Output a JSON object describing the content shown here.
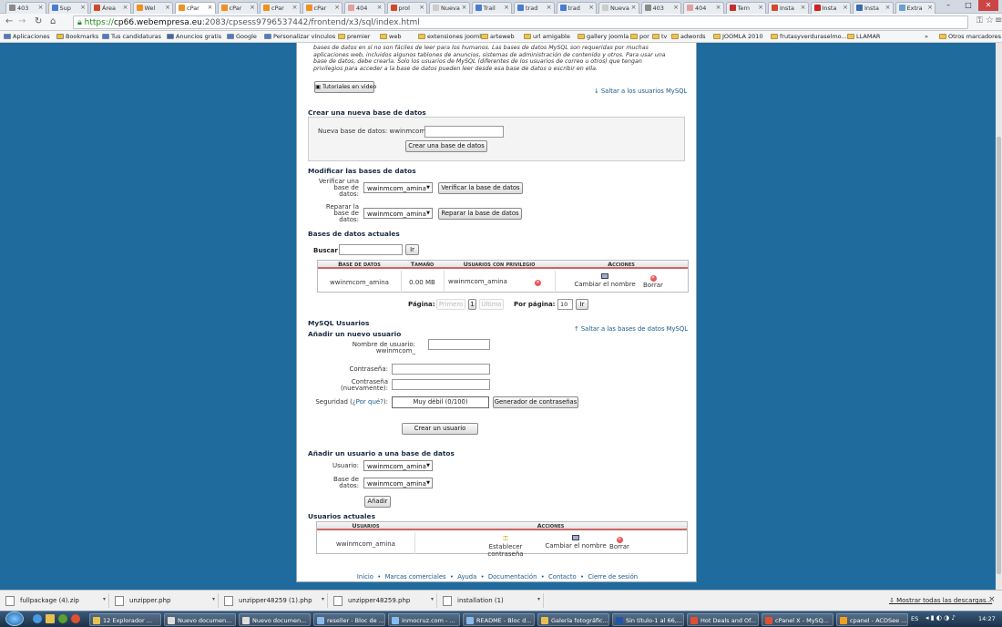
{
  "browser": {
    "tabs": [
      {
        "label": "403",
        "color": "#8a8a8a"
      },
      {
        "label": "Sup",
        "color": "#4a7bd0"
      },
      {
        "label": "Área",
        "color": "#d04a2a"
      },
      {
        "label": "Wel",
        "color": "#f09020"
      },
      {
        "label": "cPar",
        "color": "#f09020",
        "active": true
      },
      {
        "label": "cPar",
        "color": "#f09020"
      },
      {
        "label": "cPar",
        "color": "#f09020"
      },
      {
        "label": "cPar",
        "color": "#f09020"
      },
      {
        "label": "404",
        "color": "#e0a0a0"
      },
      {
        "label": "prol",
        "color": "#d04a2a"
      },
      {
        "label": "Nueva",
        "color": "#cccccc"
      },
      {
        "label": "Trail",
        "color": "#4a7bd0"
      },
      {
        "label": "trad",
        "color": "#4a7bd0"
      },
      {
        "label": "trad",
        "color": "#4a7bd0"
      },
      {
        "label": "Nueva",
        "color": "#cccccc"
      },
      {
        "label": "403",
        "color": "#8a8a8a"
      },
      {
        "label": "404",
        "color": "#e0a0a0"
      },
      {
        "label": "Tern",
        "color": "#c03030"
      },
      {
        "label": "Insta",
        "color": "#d04a2a"
      },
      {
        "label": "Insta",
        "color": "#d02020"
      },
      {
        "label": "Insta",
        "color": "#3a6ab0"
      },
      {
        "label": "Extra",
        "color": "#6aa0d0"
      }
    ],
    "url_scheme": "https://",
    "url_host": "cp66.webempresa.eu",
    "url_path": ":2083/cpsess9796537442/frontend/x3/sql/index.html",
    "bookmarks": [
      {
        "label": "Aplicaciones"
      },
      {
        "label": "Bookmarks"
      },
      {
        "label": "Tus candidaturas"
      },
      {
        "label": "Anuncios gratis"
      },
      {
        "label": "Google"
      },
      {
        "label": "Personalizar vínculos"
      },
      {
        "label": "premier"
      },
      {
        "label": "web"
      },
      {
        "label": "extensiones joomla"
      },
      {
        "label": "arteweb"
      },
      {
        "label": "url amigable"
      },
      {
        "label": "gallery joomla"
      },
      {
        "label": "por"
      },
      {
        "label": "tv"
      },
      {
        "label": "adwords"
      },
      {
        "label": "JOOMLA 2010"
      },
      {
        "label": "frutasyverduraselmo..."
      },
      {
        "label": "LLAMAR"
      }
    ],
    "other_bookmarks": "Otros marcadores",
    "more": "»"
  },
  "page": {
    "intro_lines": [
      "bases de datos en sí no son fáciles de leer para los humanos. Las bases de datos MySQL son requeridas por muchas",
      "aplicaciones web, incluidos algunos tablones de anuncios, sistemas de administración de contenido y otros. Para usar una",
      "base de datos, debe crearla. Solo los usuarios de MySQL (diferentes de los usuarios de correo u otros) que tengan",
      "privilegios para acceder a la base de datos pueden leer desde esa base de datos o escribir en ella."
    ],
    "video_button": "Tutoriales en video",
    "jump_users_link": "↓ Saltar a los usuarios MySQL",
    "create_db": {
      "heading": "Crear una nueva base de datos",
      "label": "Nueva base de datos:",
      "prefix": "wwinmcom_",
      "value": "",
      "button": "Crear una base de datos"
    },
    "modify_db": {
      "heading": "Modificar las bases de datos",
      "check_label": "Verificar una base de datos:",
      "check_select": "wwinmcom_amina",
      "check_button": "Verificar la base de datos",
      "repair_label": "Reparar la base de datos:",
      "repair_select": "wwinmcom_amina",
      "repair_button": "Reparar la base de datos"
    },
    "current_dbs": {
      "heading": "Bases de datos actuales",
      "search_label": "Buscar",
      "search_value": "",
      "go_button": "Ir",
      "columns": [
        "Base de datos",
        "Tamaño",
        "Usuarios con privilegio",
        "Acciones"
      ],
      "rows": [
        {
          "name": "wwinmcom_amina",
          "size": "0.00 MB",
          "user": "wwinmcom_amina",
          "action_rename": "Cambiar el nombre",
          "action_delete": "Borrar"
        }
      ],
      "pagination": {
        "label": "Página:",
        "first": "Primero",
        "current": "1",
        "last": "Último",
        "per_page_label": "Por página:",
        "per_page_value": "10",
        "go": "Ir"
      }
    },
    "mysql_users": {
      "heading": "MySQL Usuarios",
      "subheading": "Añadir un nuevo usuario",
      "jump_db_link": "↑ Saltar a las bases de datos MySQL",
      "username_label": "Nombre de usuario:",
      "username_prefix": "wwinmcom_",
      "password_label": "Contraseña:",
      "password2_label": "Contraseña (nuevamente):",
      "security_label": "Seguridad (",
      "security_why": "¿Por qué?",
      "security_suffix": "):",
      "strength": "Muy débil (0/100)",
      "generator_button": "Generador de contraseñas",
      "create_button": "Crear un usuario"
    },
    "add_user_db": {
      "heading": "Añadir un usuario a una base de datos",
      "user_label": "Usuario:",
      "user_select": "wwinmcom_amina",
      "db_label": "Base de datos:",
      "db_select": "wwinmcom_amina",
      "add_button": "Añadir"
    },
    "current_users": {
      "heading": "Usuarios actuales",
      "columns": [
        "Usuarios",
        "Acciones"
      ],
      "rows": [
        {
          "name": "wwinmcom_amina",
          "set_password": "Establecer contraseña",
          "rename": "Cambiar el nombre",
          "delete": "Borrar"
        }
      ]
    },
    "footer_links": [
      "Inicio",
      "Marcas comerciales",
      "Ayuda",
      "Documentación",
      "Contacto",
      "Cierre de sesión"
    ]
  },
  "downloads": {
    "items": [
      "fullpackage (4).zip",
      "unzipper.php",
      "unzipper48259 (1).php",
      "unzipper48259.php",
      "installation (1)"
    ],
    "show_all": "Mostrar todas las descargas...",
    "close": "×"
  },
  "taskbar": {
    "items": [
      {
        "label": "12 Explorador ...",
        "color": "#e8c050"
      },
      {
        "label": "Nuevo documen...",
        "color": "#dddddd"
      },
      {
        "label": "Nuevo documen...",
        "color": "#dddddd"
      },
      {
        "label": "reseller - Bloc de ...",
        "color": "#88bbee"
      },
      {
        "label": "inmocruz.com - ...",
        "color": "#88bbee"
      },
      {
        "label": "README - Bloc d...",
        "color": "#88bbee"
      },
      {
        "label": "Galería fotográfic...",
        "color": "#e8c050"
      },
      {
        "label": "Sin título-1 al 66,...",
        "color": "#2255aa"
      },
      {
        "label": "Hot Deals and Of...",
        "color": "#e05030"
      },
      {
        "label": "cPanel X - MySQ...",
        "color": "#e05030"
      },
      {
        "label": "cpanel - ACDSee ...",
        "color": "#f0a020"
      }
    ],
    "lang": "ES",
    "time": "14:27"
  }
}
